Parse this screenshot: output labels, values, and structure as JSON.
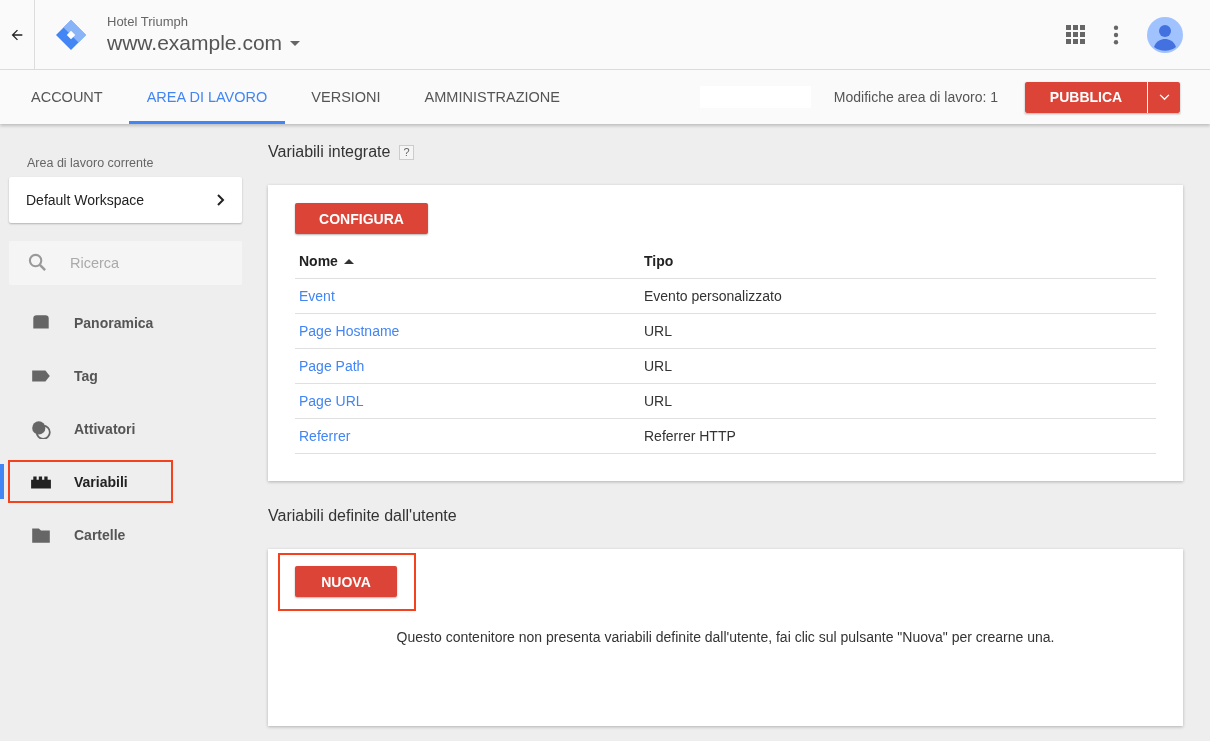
{
  "header": {
    "account": "Hotel Triumph",
    "container": "www.example.com"
  },
  "tabs": [
    {
      "label": "ACCOUNT",
      "selected": false
    },
    {
      "label": "AREA DI LAVORO",
      "selected": true
    },
    {
      "label": "VERSIONI",
      "selected": false
    },
    {
      "label": "AMMINISTRAZIONE",
      "selected": false
    }
  ],
  "workspace_changes": "Modifiche area di lavoro: 1",
  "publish_button": "PUBBLICA",
  "sidebar": {
    "workspace_label": "Area di lavoro corrente",
    "workspace": "Default Workspace",
    "search": {
      "placeholder": "Ricerca"
    },
    "items": [
      {
        "label": "Panoramica",
        "kind": "overview",
        "selected": false,
        "highlighted": false
      },
      {
        "label": "Tag",
        "kind": "tag",
        "selected": false,
        "highlighted": false
      },
      {
        "label": "Attivatori",
        "kind": "trigger",
        "selected": false,
        "highlighted": false
      },
      {
        "label": "Variabili",
        "kind": "variable",
        "selected": true,
        "highlighted": true
      },
      {
        "label": "Cartelle",
        "kind": "folder",
        "selected": false,
        "highlighted": false
      }
    ]
  },
  "builtin": {
    "title": "Variabili integrate",
    "help": "?",
    "button": "CONFIGURA",
    "columns": [
      "Nome",
      "Tipo"
    ],
    "rows": [
      {
        "name": "Event",
        "type": "Evento personalizzato"
      },
      {
        "name": "Page Hostname",
        "type": "URL"
      },
      {
        "name": "Page Path",
        "type": "URL"
      },
      {
        "name": "Page URL",
        "type": "URL"
      },
      {
        "name": "Referrer",
        "type": "Referrer HTTP"
      }
    ]
  },
  "user_defined": {
    "title": "Variabili definite dall'utente",
    "button": "NUOVA",
    "button_highlighted": true,
    "message": "Questo contenitore non presenta variabili definite dall'utente, fai clic sul pulsante \"Nuova\" per crearne una."
  }
}
